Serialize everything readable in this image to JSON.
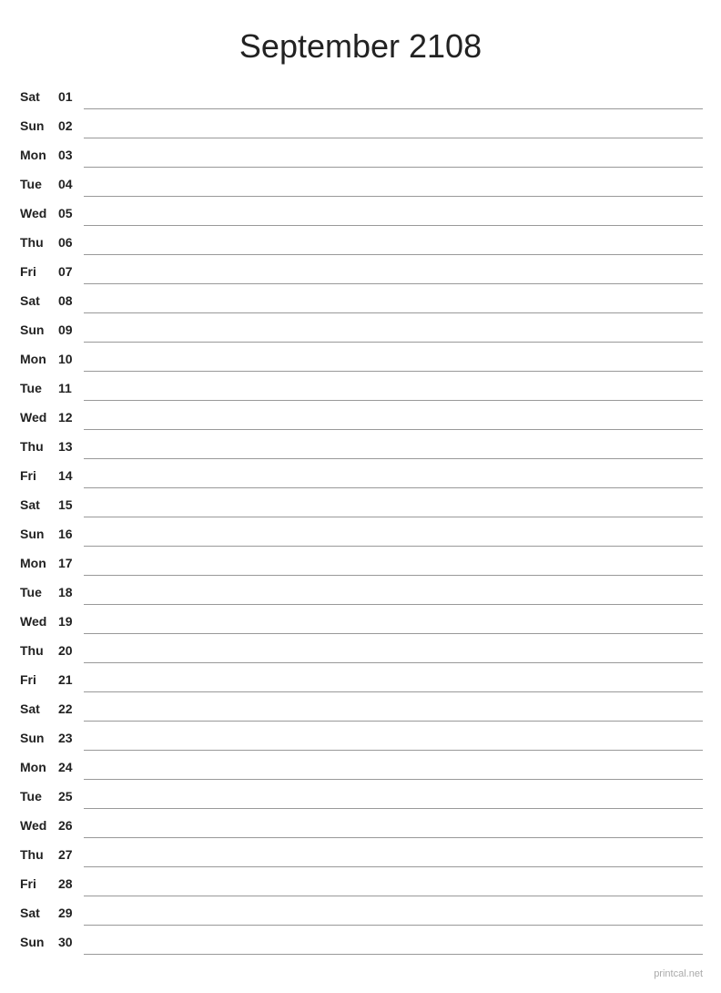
{
  "title": "September 2108",
  "footer": "printcal.net",
  "days": [
    {
      "name": "Sat",
      "num": "01"
    },
    {
      "name": "Sun",
      "num": "02"
    },
    {
      "name": "Mon",
      "num": "03"
    },
    {
      "name": "Tue",
      "num": "04"
    },
    {
      "name": "Wed",
      "num": "05"
    },
    {
      "name": "Thu",
      "num": "06"
    },
    {
      "name": "Fri",
      "num": "07"
    },
    {
      "name": "Sat",
      "num": "08"
    },
    {
      "name": "Sun",
      "num": "09"
    },
    {
      "name": "Mon",
      "num": "10"
    },
    {
      "name": "Tue",
      "num": "11"
    },
    {
      "name": "Wed",
      "num": "12"
    },
    {
      "name": "Thu",
      "num": "13"
    },
    {
      "name": "Fri",
      "num": "14"
    },
    {
      "name": "Sat",
      "num": "15"
    },
    {
      "name": "Sun",
      "num": "16"
    },
    {
      "name": "Mon",
      "num": "17"
    },
    {
      "name": "Tue",
      "num": "18"
    },
    {
      "name": "Wed",
      "num": "19"
    },
    {
      "name": "Thu",
      "num": "20"
    },
    {
      "name": "Fri",
      "num": "21"
    },
    {
      "name": "Sat",
      "num": "22"
    },
    {
      "name": "Sun",
      "num": "23"
    },
    {
      "name": "Mon",
      "num": "24"
    },
    {
      "name": "Tue",
      "num": "25"
    },
    {
      "name": "Wed",
      "num": "26"
    },
    {
      "name": "Thu",
      "num": "27"
    },
    {
      "name": "Fri",
      "num": "28"
    },
    {
      "name": "Sat",
      "num": "29"
    },
    {
      "name": "Sun",
      "num": "30"
    }
  ]
}
